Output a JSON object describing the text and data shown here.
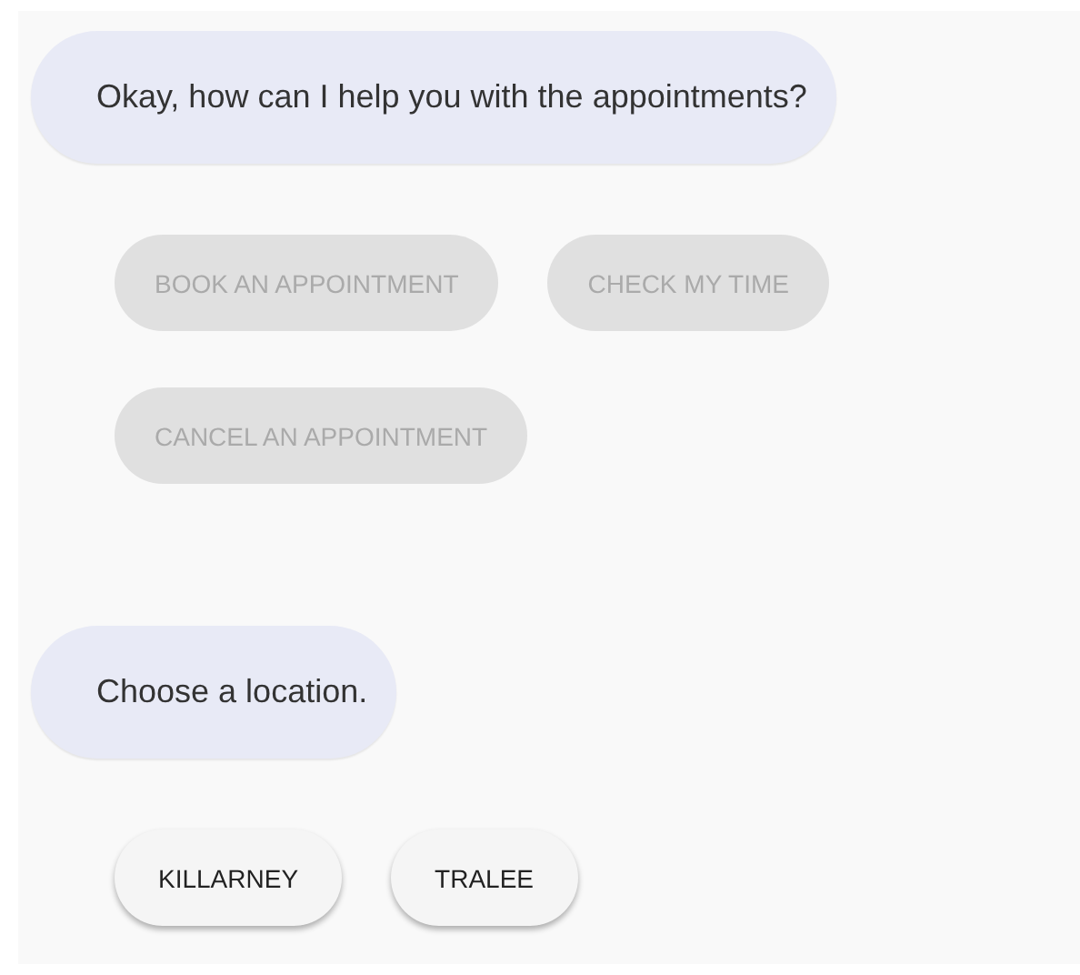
{
  "messages": [
    {
      "text": "Okay, how can I help you with the appointments?",
      "chips": [
        {
          "label": "BOOK AN APPOINTMENT",
          "disabled": true
        },
        {
          "label": "CHECK MY TIME",
          "disabled": true
        },
        {
          "label": "CANCEL AN APPOINTMENT",
          "disabled": true
        }
      ]
    },
    {
      "text": "Choose a location.",
      "chips": [
        {
          "label": "KILLARNEY",
          "disabled": false
        },
        {
          "label": "TRALEE",
          "disabled": false
        }
      ]
    }
  ]
}
